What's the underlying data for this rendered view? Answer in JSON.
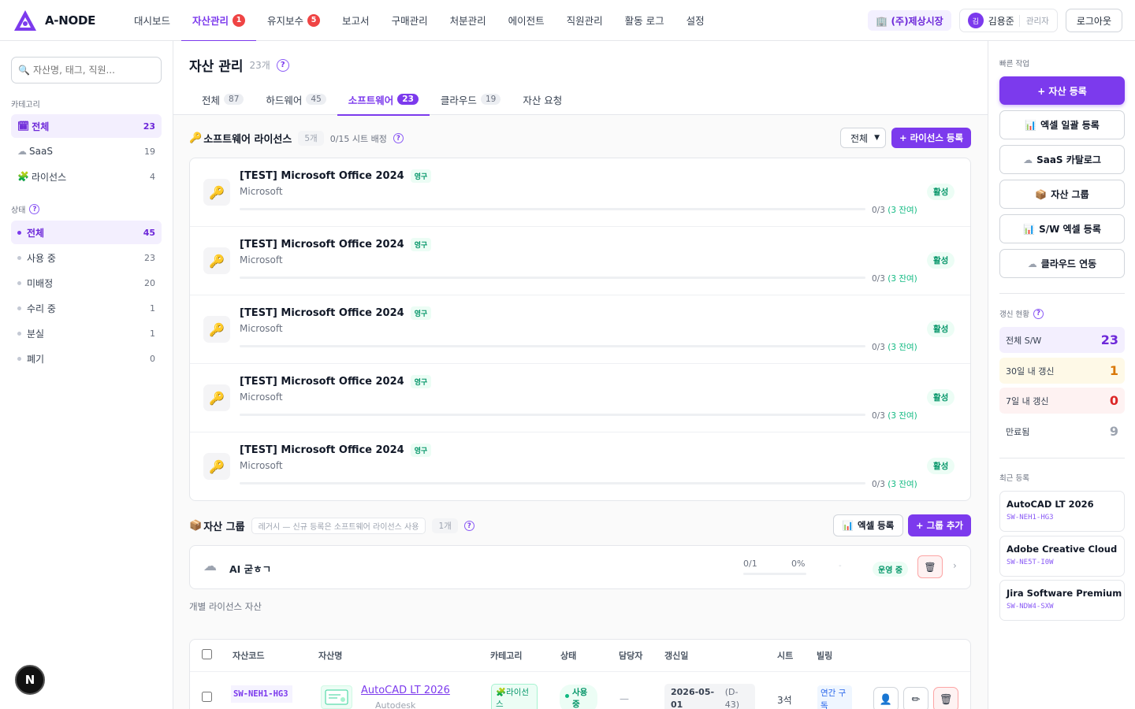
{
  "app": {
    "logo_text": "A-NODE"
  },
  "nav": [
    {
      "label": "대시보드",
      "badge": ""
    },
    {
      "label": "자산관리",
      "badge": "1"
    },
    {
      "label": "유지보수",
      "badge": "5"
    },
    {
      "label": "보고서",
      "badge": ""
    },
    {
      "label": "구매관리",
      "badge": ""
    },
    {
      "label": "처분관리",
      "badge": ""
    },
    {
      "label": "에이전트",
      "badge": ""
    },
    {
      "label": "직원관리",
      "badge": ""
    },
    {
      "label": "활동 로그",
      "badge": ""
    },
    {
      "label": "설정",
      "badge": ""
    }
  ],
  "header": {
    "company": "🏢 (주)제상시장",
    "avatar_initial": "김",
    "user_name": "김용준",
    "user_role": "관리자",
    "logout_label": "로그아웃"
  },
  "sidebar": {
    "search_placeholder": "자산명, 태그, 직원...",
    "category_title": "카테고리",
    "categories": [
      {
        "icon": "🗓",
        "label": "전체",
        "count": "23"
      },
      {
        "icon": "☁",
        "label": "SaaS",
        "count": "19"
      },
      {
        "icon": "🧩",
        "label": "라이선스",
        "count": "4"
      }
    ],
    "status_title": "상태",
    "statuses": [
      {
        "label": "전체",
        "count": "45"
      },
      {
        "label": "사용 중",
        "count": "23"
      },
      {
        "label": "미배정",
        "count": "20"
      },
      {
        "label": "수리 중",
        "count": "1"
      },
      {
        "label": "분실",
        "count": "1"
      },
      {
        "label": "폐기",
        "count": "0"
      }
    ],
    "fab_label": "N"
  },
  "main": {
    "title": "자산 관리",
    "count": "23개",
    "tabs": [
      {
        "label": "전체",
        "count": "87"
      },
      {
        "label": "하드웨어",
        "count": "45"
      },
      {
        "label": "소프트웨어",
        "count": "23"
      },
      {
        "label": "클라우드",
        "count": "19"
      },
      {
        "label": "자산 요청",
        "count": ""
      }
    ],
    "license_section": {
      "icon": "🔑",
      "title": "소프트웨어 라이선스",
      "count": "5개",
      "seats": "0/15 시트 배정",
      "filter_value": "전체",
      "add_button": "+ 라이선스 등록",
      "items": [
        {
          "name": "[TEST] Microsoft Office 2024",
          "tag": "영구",
          "vendor": "Microsoft",
          "seats": "0/3",
          "remaining": "(3 잔여)",
          "status": "활성"
        },
        {
          "name": "[TEST] Microsoft Office 2024",
          "tag": "영구",
          "vendor": "Microsoft",
          "seats": "0/3",
          "remaining": "(3 잔여)",
          "status": "활성"
        },
        {
          "name": "[TEST] Microsoft Office 2024",
          "tag": "영구",
          "vendor": "Microsoft",
          "seats": "0/3",
          "remaining": "(3 잔여)",
          "status": "활성"
        },
        {
          "name": "[TEST] Microsoft Office 2024",
          "tag": "영구",
          "vendor": "Microsoft",
          "seats": "0/3",
          "remaining": "(3 잔여)",
          "status": "활성"
        },
        {
          "name": "[TEST] Microsoft Office 2024",
          "tag": "영구",
          "vendor": "Microsoft",
          "seats": "0/3",
          "remaining": "(3 잔여)",
          "status": "활성"
        }
      ]
    },
    "group_section": {
      "icon": "📦",
      "title": "자산 그룹",
      "note": "레거시 — 신규 등록은 소프트웨어 라이선스 사용",
      "count": "1개",
      "excel_button": "엑셀 등록",
      "add_button": "+ 그룹 추가",
      "group": {
        "icon": "☁",
        "name": "AI 굳ㅎㄱ",
        "seats": "0/1",
        "percent": "0%",
        "dash": "-",
        "status": "운영 중"
      }
    },
    "individual_title": "개별 라이선스 자산",
    "table": {
      "headers": [
        "자산코드",
        "자산명",
        "카테고리",
        "상태",
        "담당자",
        "갱신일",
        "시트",
        "빌링"
      ],
      "rows": [
        {
          "code": "SW-NEH1-HG3",
          "name": "AutoCAD LT 2026",
          "vendor": "Autodesk",
          "category": "🧩라이선스",
          "status": "사용 중",
          "owner": "—",
          "renewal": "2026-05-01",
          "dday": "(D-43)",
          "seats": "3석",
          "billing": "연간 구독"
        }
      ]
    }
  },
  "right_panel": {
    "quick_title": "빠른 작업",
    "quick_actions": [
      {
        "icon": "",
        "label": "+ 자산 등록"
      },
      {
        "icon": "📊",
        "label": "엑셀 일괄 등록"
      },
      {
        "icon": "☁",
        "label": "SaaS 카탈로그"
      },
      {
        "icon": "📦",
        "label": "자산 그룹"
      },
      {
        "icon": "📊",
        "label": "S/W 엑셀 등록"
      },
      {
        "icon": "☁",
        "label": "클라우드 연동"
      }
    ],
    "renew_title": "갱신 현황",
    "renew_stats": [
      {
        "label": "전체 S/W",
        "value": "23",
        "bg": "#f3effe",
        "color": "#6d28d9"
      },
      {
        "label": "30일 내 갱신",
        "value": "1",
        "bg": "#fef9e7",
        "color": "#d97706"
      },
      {
        "label": "7일 내 갱신",
        "value": "0",
        "bg": "#fef2f2",
        "color": "#dc2626"
      },
      {
        "label": "만료됨",
        "value": "9",
        "bg": "#ffffff",
        "color": "#9ca3af"
      }
    ],
    "recent_title": "최근 등록",
    "recent": [
      {
        "name": "AutoCAD LT 2026",
        "code": "SW-NEH1-HG3"
      },
      {
        "name": "Adobe Creative Cloud",
        "code": "SW-NE5T-I0W"
      },
      {
        "name": "Jira Software Premium",
        "code": "SW-NDW4-SXW"
      }
    ]
  },
  "colors": {
    "accent": "#7c3aed",
    "success": "#059669",
    "danger": "#ef4444"
  }
}
